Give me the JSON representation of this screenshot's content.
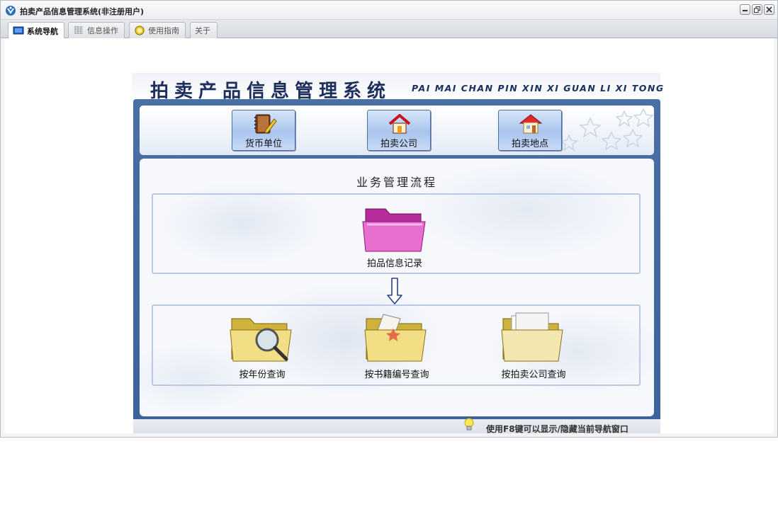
{
  "window": {
    "title": "拍卖产品信息管理系统(非注册用户)"
  },
  "tabs": [
    {
      "label": "系统导航",
      "icon": "monitor-icon",
      "active": true
    },
    {
      "label": "信息操作",
      "icon": "grid-icon",
      "active": false
    },
    {
      "label": "使用指南",
      "icon": "help-icon",
      "active": false
    },
    {
      "label": "关于",
      "icon": "",
      "active": false
    }
  ],
  "banner": {
    "title": "拍卖产品信息管理系统",
    "subtitle": "PAI MAI CHAN PIN XIN XI GUAN LI XI TONG"
  },
  "nav_buttons": [
    {
      "label": "货币单位",
      "icon": "notebook-pen-icon"
    },
    {
      "label": "拍卖公司",
      "icon": "house-icon"
    },
    {
      "label": "拍卖地点",
      "icon": "house-red-roof-icon"
    }
  ],
  "flow": {
    "title": "业务管理流程",
    "record": {
      "label": "拍品信息记录",
      "icon": "pink-folder-icon"
    },
    "queries": [
      {
        "label": "按年份查询",
        "icon": "folder-search-icon"
      },
      {
        "label": "按书籍编号查询",
        "icon": "folder-star-icon"
      },
      {
        "label": "按拍卖公司查询",
        "icon": "folder-documents-icon"
      }
    ]
  },
  "status": {
    "hint": "使用F8键可以显示/隐藏当前导航窗口",
    "icon": "lightbulb-icon"
  },
  "colors": {
    "panel_blue": "#3c6299",
    "banner_navy": "#1d2e5e",
    "nav_button": "#a9c4ec",
    "box_border": "#b9c9e4"
  }
}
